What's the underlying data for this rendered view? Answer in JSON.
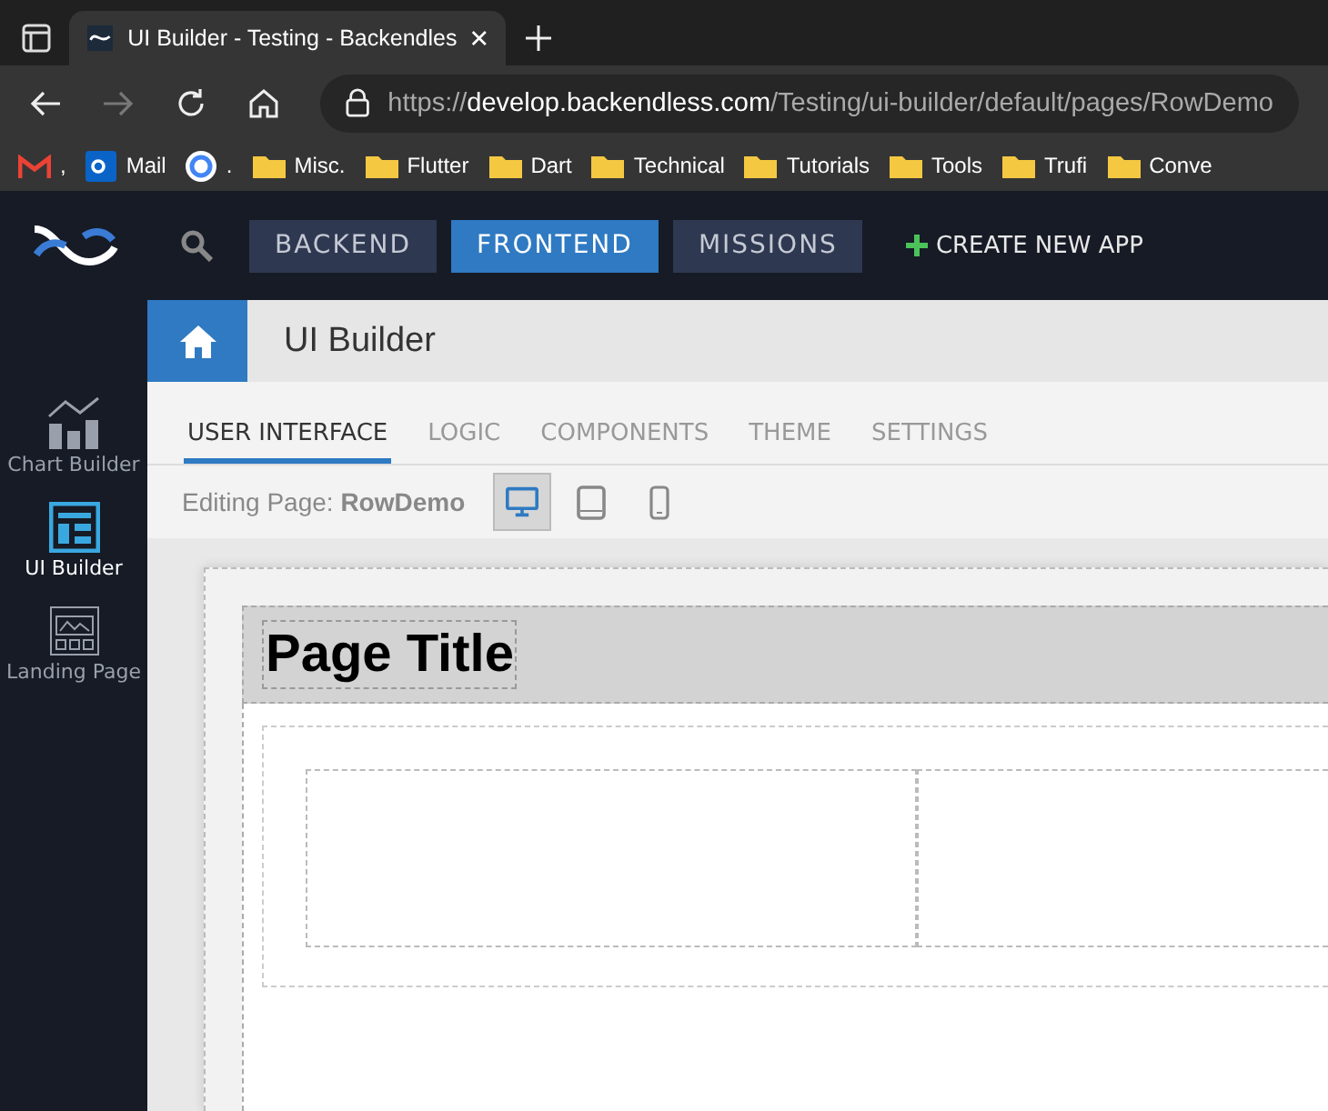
{
  "browser": {
    "tab_title": "UI Builder - Testing - Backendles",
    "url": {
      "scheme": "https://",
      "host": "develop.backendless.com",
      "path": "/Testing/ui-builder/default/pages/RowDemo"
    }
  },
  "bookmarks": [
    {
      "label": ",",
      "kind": "gmail"
    },
    {
      "label": "Mail",
      "kind": "mail"
    },
    {
      "label": ".",
      "kind": "google"
    },
    {
      "label": "Misc.",
      "kind": "folder"
    },
    {
      "label": "Flutter",
      "kind": "folder"
    },
    {
      "label": "Dart",
      "kind": "folder"
    },
    {
      "label": "Technical",
      "kind": "folder"
    },
    {
      "label": "Tutorials",
      "kind": "folder"
    },
    {
      "label": "Tools",
      "kind": "folder"
    },
    {
      "label": "Trufi",
      "kind": "folder"
    },
    {
      "label": "Conve",
      "kind": "folder"
    }
  ],
  "top_nav": {
    "items": [
      {
        "label": "BACKEND",
        "selected": false
      },
      {
        "label": "FRONTEND",
        "selected": true
      },
      {
        "label": "MISSIONS",
        "selected": false
      }
    ],
    "create": "CREATE NEW APP"
  },
  "sidebar": {
    "items": [
      {
        "label": "Chart Builder",
        "kind": "chart",
        "selected": false
      },
      {
        "label": "UI Builder",
        "kind": "layout",
        "selected": true
      },
      {
        "label": "Landing Page",
        "kind": "landing",
        "selected": false
      }
    ]
  },
  "section_title": "UI Builder",
  "tabs": [
    {
      "label": "USER INTERFACE",
      "selected": true
    },
    {
      "label": "LOGIC",
      "selected": false
    },
    {
      "label": "COMPONENTS",
      "selected": false
    },
    {
      "label": "THEME",
      "selected": false
    },
    {
      "label": "SETTINGS",
      "selected": false
    }
  ],
  "editing": {
    "label": "Editing Page:",
    "page": "RowDemo",
    "devices": [
      {
        "kind": "desktop",
        "selected": true
      },
      {
        "kind": "tablet",
        "selected": false
      },
      {
        "kind": "phone",
        "selected": false
      }
    ]
  },
  "canvas": {
    "page_title": "Page Title"
  }
}
